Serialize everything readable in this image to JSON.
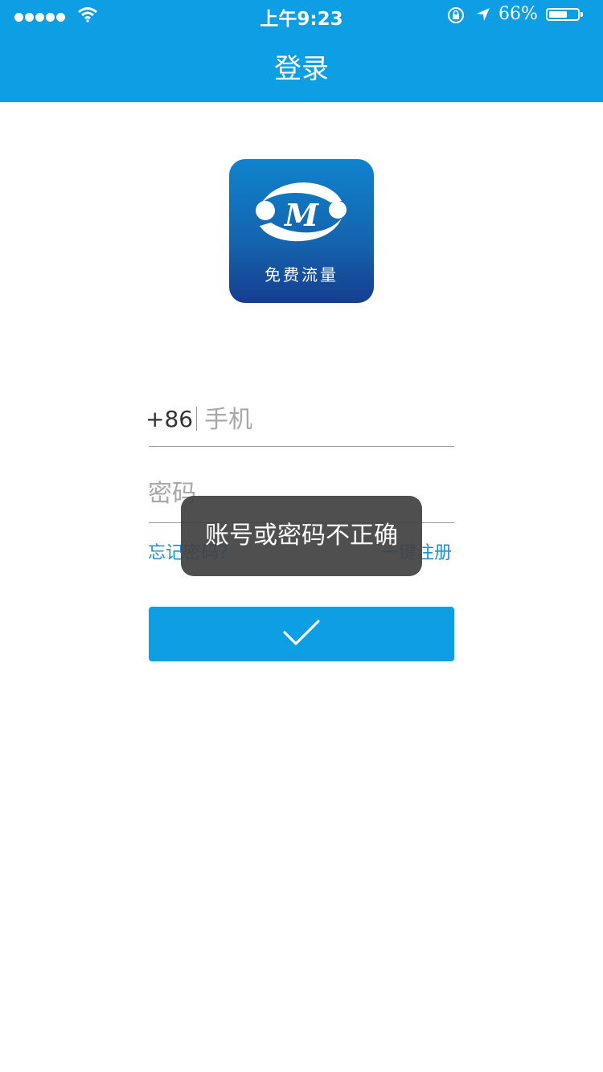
{
  "status_bar": {
    "time": "上午9:23",
    "battery_percent": "66%",
    "battery_level": 0.66,
    "signal_bars": 5
  },
  "nav": {
    "title": "登录"
  },
  "logo": {
    "text": "免费流量"
  },
  "form": {
    "country_code": "+86",
    "phone_placeholder": "手机",
    "password_placeholder": "密码",
    "forgot_password": "忘记密码?",
    "register": "一键注册"
  },
  "toast": {
    "message": "账号或密码不正确"
  },
  "icons": {
    "submit": "checkmark-icon",
    "wifi": "wifi-icon",
    "orientation_lock": "orientation-lock-icon",
    "location": "location-arrow-icon",
    "battery": "battery-icon"
  },
  "colors": {
    "primary": "#0d9ee4",
    "link": "#1b8fd7",
    "toast_bg": "#424242"
  }
}
